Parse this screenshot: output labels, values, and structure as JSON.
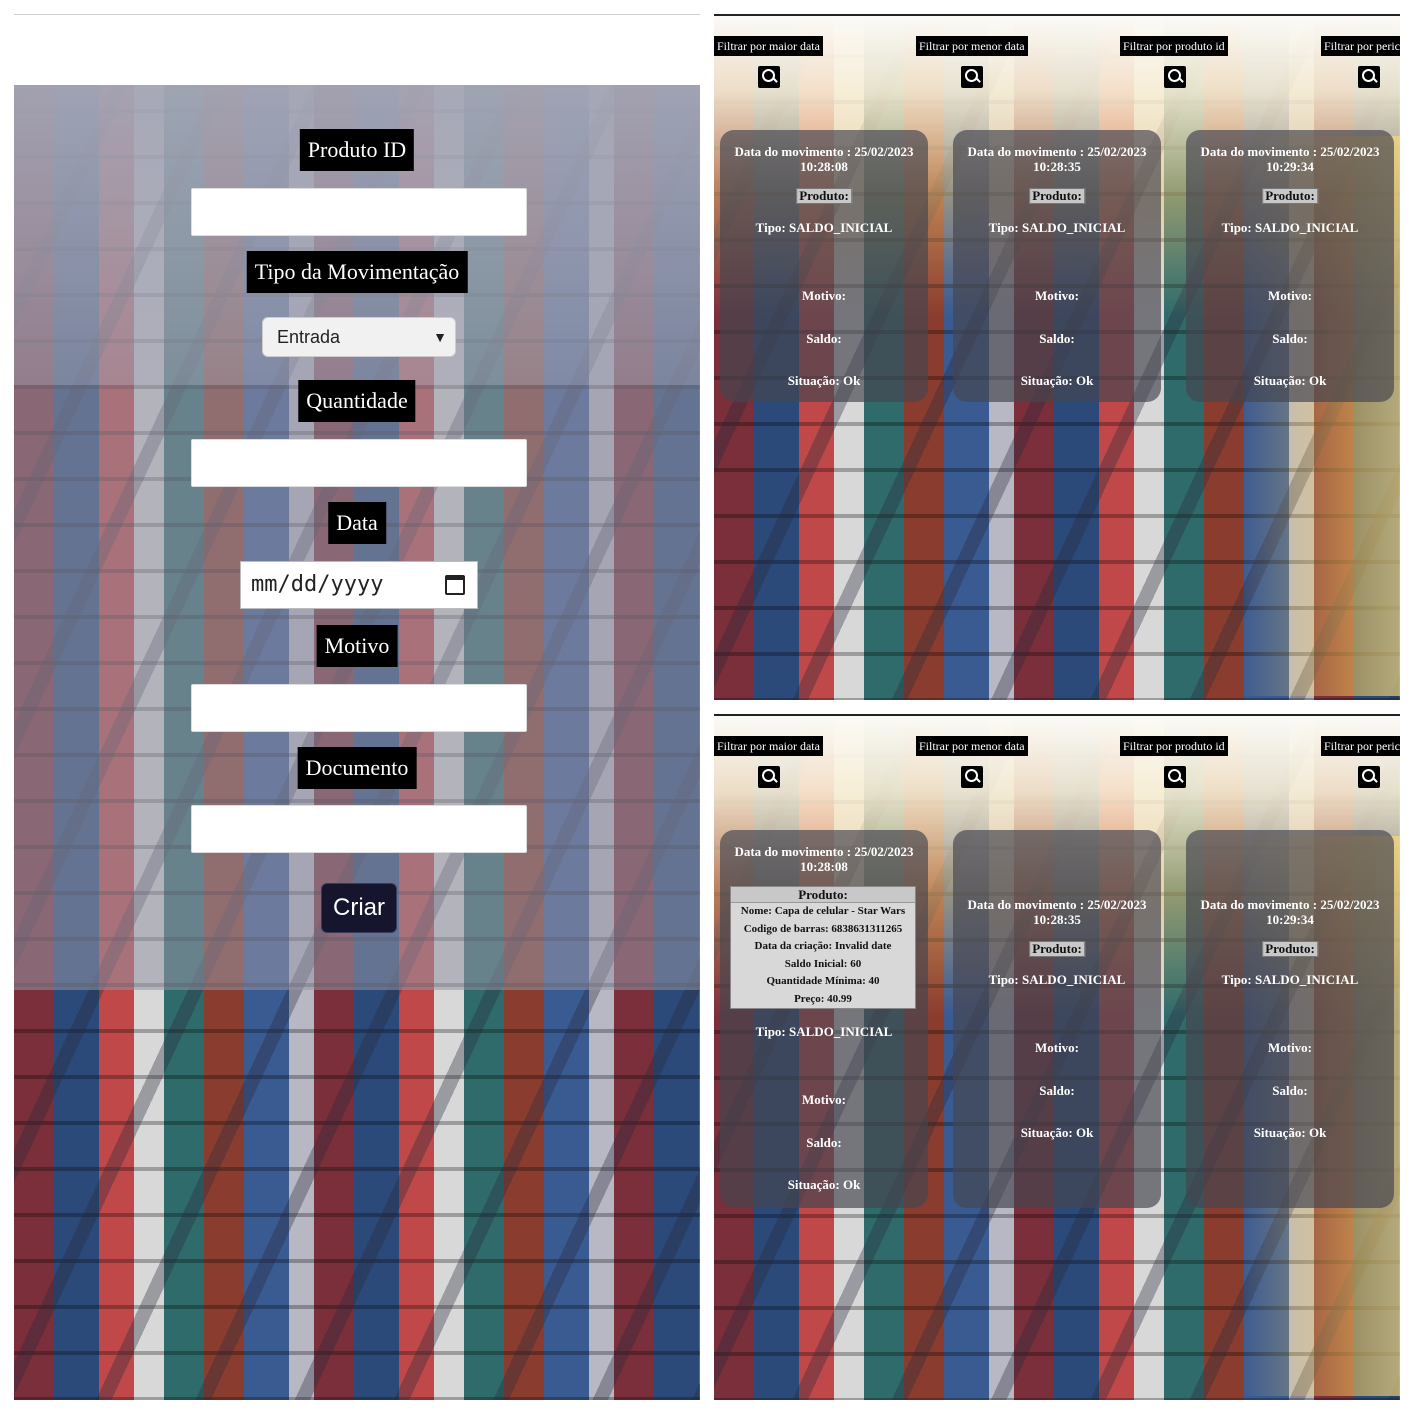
{
  "form": {
    "produto_id_label": "Produto ID",
    "tipo_label": "Tipo da Movimentação",
    "tipo_selected": "Entrada",
    "quantidade_label": "Quantidade",
    "data_label": "Data",
    "data_placeholder": "mm/dd/yyyy",
    "motivo_label": "Motivo",
    "documento_label": "Documento",
    "criar_label": "Criar"
  },
  "filters": {
    "maior_data": "Filtrar por maior data",
    "menor_data": "Filtrar por menor data",
    "produto_id": "Filtrar por produto id",
    "periodo": "Filtrar por peric"
  },
  "cards": [
    {
      "data": "Data do movimento : 25/02/2023",
      "hora": "10:28:08",
      "produto": "Produto:",
      "tipo": "Tipo: SALDO_INICIAL",
      "motivo": "Motivo:",
      "saldo": "Saldo:",
      "situacao": "Situação: Ok"
    },
    {
      "data": "Data do movimento : 25/02/2023",
      "hora": "10:28:35",
      "produto": "Produto:",
      "tipo": "Tipo: SALDO_INICIAL",
      "motivo": "Motivo:",
      "saldo": "Saldo:",
      "situacao": "Situação: Ok"
    },
    {
      "data": "Data do movimento : 25/02/2023",
      "hora": "10:29:34",
      "produto": "Produto:",
      "tipo": "Tipo: SALDO_INICIAL",
      "motivo": "Motivo:",
      "saldo": "Saldo:",
      "situacao": "Situação: Ok"
    }
  ],
  "expanded_product": {
    "header": "Produto:",
    "nome": "Nome: Capa de celular - Star Wars",
    "codigo": "Codigo de barras: 6838631311265",
    "data_criacao": "Data da criação: Invalid date",
    "saldo_inicial": "Saldo Inicial: 60",
    "quantidade_minima": "Quantidade Mínima: 40",
    "preco": "Preço: 40.99"
  }
}
